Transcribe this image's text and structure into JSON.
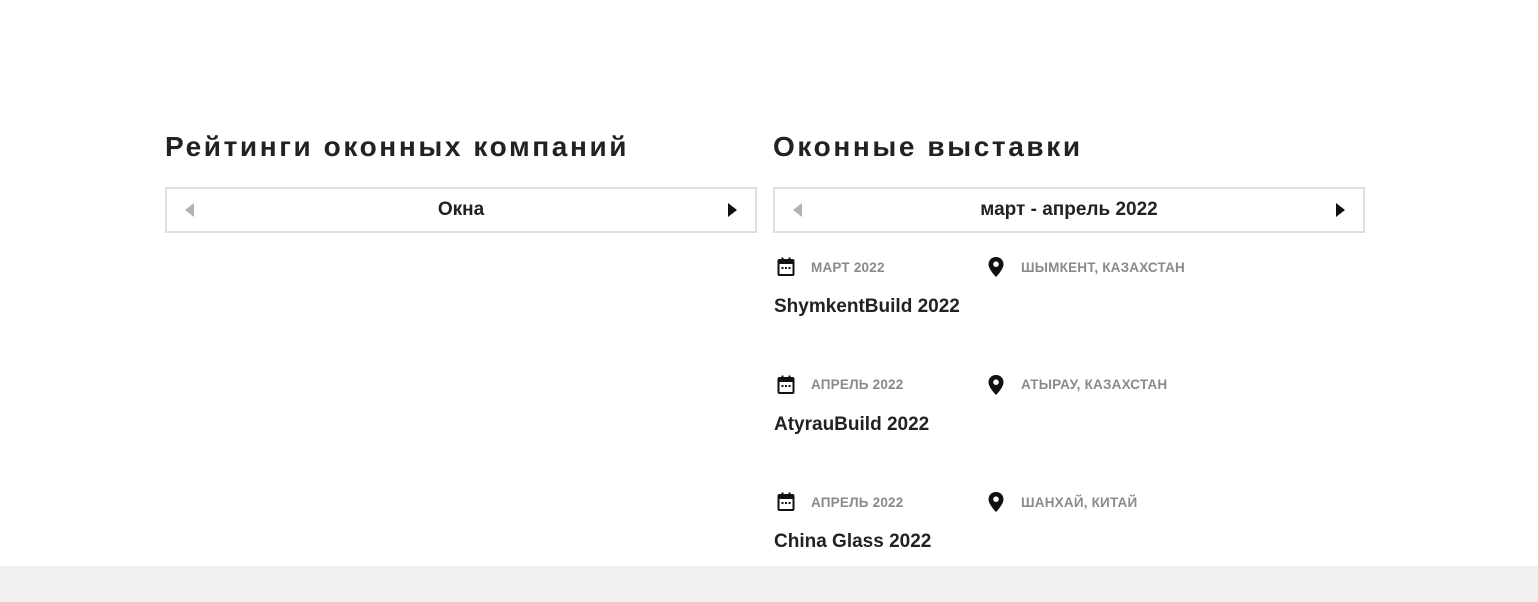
{
  "ratings": {
    "title": "Рейтинги оконных компаний",
    "switcher_label": "Окна"
  },
  "exhibitions": {
    "title": "Оконные выставки",
    "switcher_label": "март - апрель 2022",
    "events": [
      {
        "date": "МАРТ 2022",
        "location": "ШЫМКЕНТ, КАЗАХСТАН",
        "name": "ShymkentBuild 2022"
      },
      {
        "date": "АПРЕЛЬ 2022",
        "location": "АТЫРАУ, КАЗАХСТАН",
        "name": "AtyrauBuild 2022"
      },
      {
        "date": "АПРЕЛЬ 2022",
        "location": "ШАНХАЙ, КИТАЙ",
        "name": "China Glass 2022"
      }
    ]
  },
  "icons": {
    "date": "calendar-icon",
    "location": "map-pin-icon",
    "prev": "triangle-left-icon",
    "next": "triangle-right-icon"
  },
  "colors": {
    "text": "#222222",
    "meta_text": "#8a8a8a",
    "border": "#dedede",
    "arrow_disabled": "#b3b3b3",
    "arrow_active": "#111111",
    "footer_band": "#eef0f2"
  }
}
